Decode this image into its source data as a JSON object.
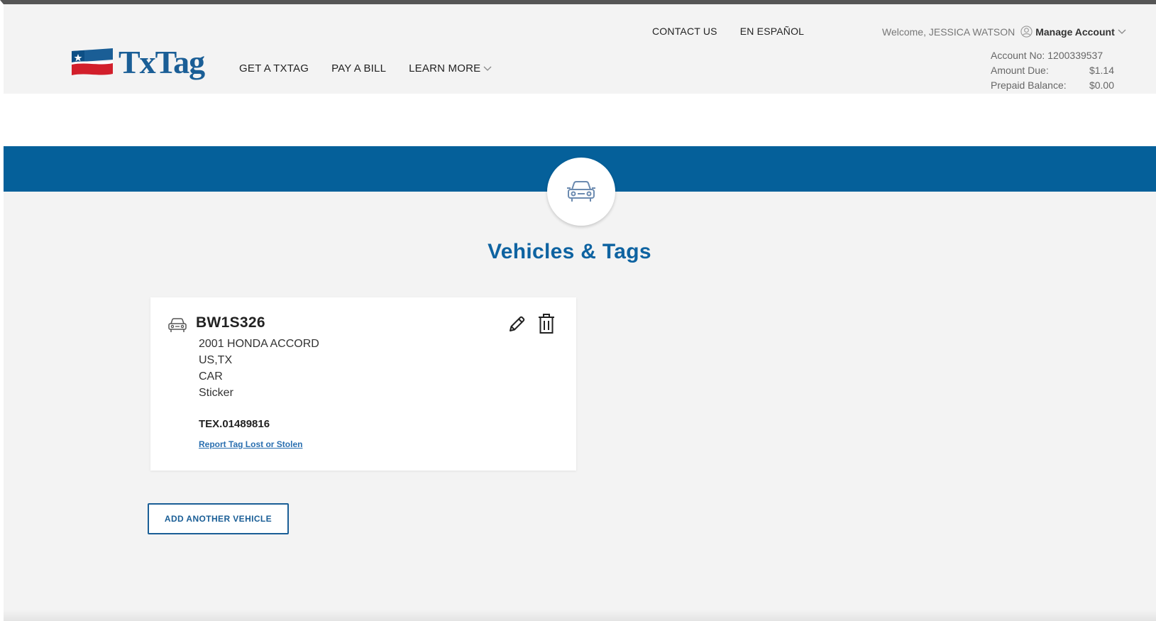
{
  "brand": {
    "name": "TxTag",
    "colors": {
      "primary_blue": "#05609a",
      "title_blue": "#0e63a1",
      "flag_red": "#d21f2b"
    }
  },
  "main_nav": {
    "items": [
      {
        "label": "GET A TXTAG"
      },
      {
        "label": "PAY A BILL"
      },
      {
        "label": "LEARN MORE"
      }
    ]
  },
  "util_nav": {
    "contact": "CONTACT US",
    "spanish": "EN ESPAÑOL"
  },
  "account": {
    "welcome": "Welcome, JESSICA WATSON",
    "manage_label": "Manage Account",
    "account_no_label": "Account No:",
    "account_no": "1200339537",
    "amount_due_label": "Amount Due:",
    "amount_due": "$1.14",
    "prepaid_label": "Prepaid Balance:",
    "prepaid": "$0.00"
  },
  "page": {
    "title": "Vehicles & Tags",
    "badge_icon": "car-icon"
  },
  "vehicles": [
    {
      "plate": "BW1S326",
      "description": "2001 HONDA ACCORD",
      "location": "US,TX",
      "type": "CAR",
      "tag_style": "Sticker",
      "tag_number": "TEX.01489816",
      "report_link": "Report Tag Lost or Stolen",
      "icons": [
        "car-icon",
        "pencil-icon",
        "trash-icon"
      ]
    }
  ],
  "actions": {
    "add_vehicle": "ADD ANOTHER VEHICLE"
  }
}
